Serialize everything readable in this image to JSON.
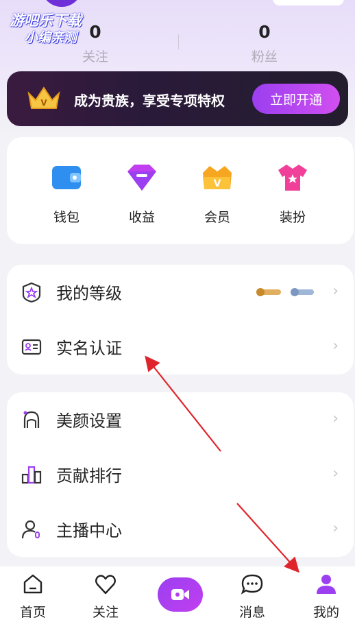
{
  "watermark": {
    "line1": "游吧乐下载",
    "line2": "小编亲测"
  },
  "stats": [
    {
      "value": "0",
      "label": "关注"
    },
    {
      "value": "0",
      "label": "粉丝"
    }
  ],
  "vip_banner": {
    "text": "成为贵族，享受专项特权",
    "button": "立即开通"
  },
  "quick_actions": [
    {
      "label": "钱包",
      "icon": "wallet-icon"
    },
    {
      "label": "收益",
      "icon": "diamond-icon"
    },
    {
      "label": "会员",
      "icon": "crown-member-icon"
    },
    {
      "label": "装扮",
      "icon": "tshirt-icon"
    }
  ],
  "menu_group_1": [
    {
      "label": "我的等级",
      "icon": "level-shield-icon"
    },
    {
      "label": "实名认证",
      "icon": "id-card-icon"
    }
  ],
  "menu_group_2": [
    {
      "label": "美颜设置",
      "icon": "beauty-face-icon"
    },
    {
      "label": "贡献排行",
      "icon": "ranking-bars-icon"
    },
    {
      "label": "主播中心",
      "icon": "streamer-user-icon"
    }
  ],
  "chevron": "›",
  "tabs": [
    {
      "label": "首页",
      "icon": "home-icon"
    },
    {
      "label": "关注",
      "icon": "heart-icon"
    },
    {
      "label": "",
      "icon": "video-camera-icon"
    },
    {
      "label": "消息",
      "icon": "message-icon"
    },
    {
      "label": "我的",
      "icon": "profile-icon"
    }
  ],
  "colors": {
    "accent": "#9b3ff0",
    "banner_bg": "#2a1a3a",
    "arrow": "#e0242b"
  }
}
